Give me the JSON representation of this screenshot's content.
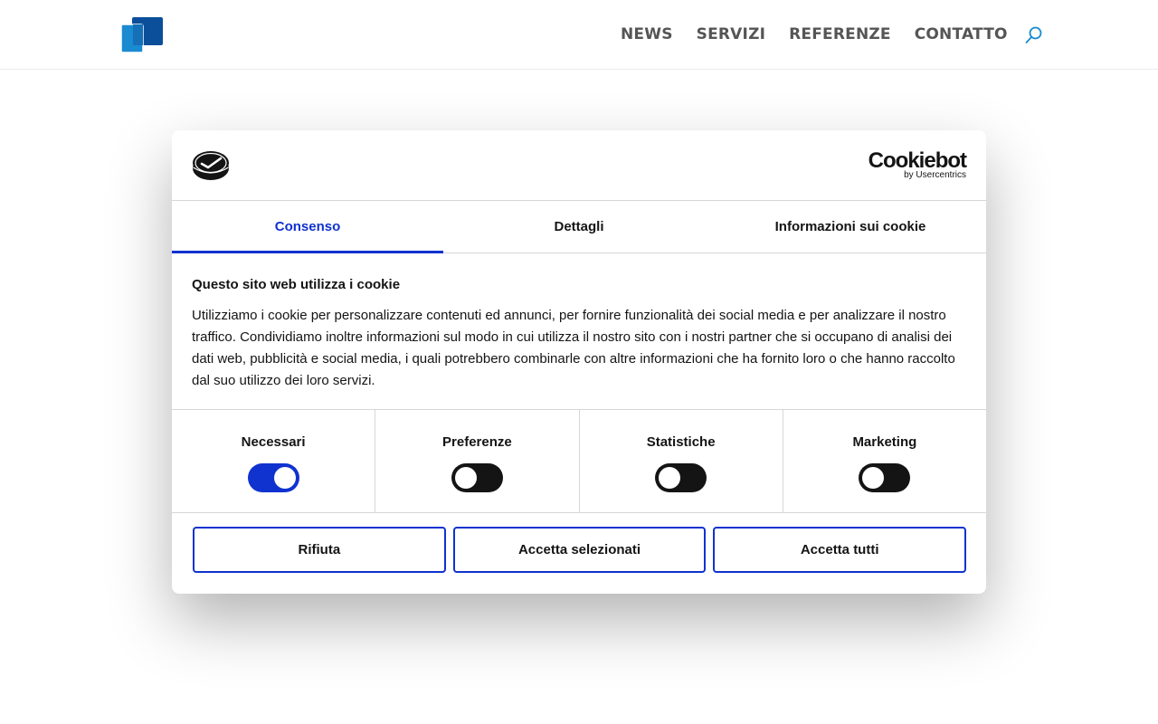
{
  "header": {
    "logo_icon": "company-logo",
    "nav": [
      "NEWS",
      "SERVIZI",
      "REFERENZE",
      "CONTATTO"
    ],
    "search_icon": "search-icon"
  },
  "dialog": {
    "brand_icon": "cookie-brand-mark",
    "provider": {
      "name": "Cookiebot",
      "by": "by Usercentrics"
    },
    "tabs": [
      {
        "label": "Consenso",
        "active": true
      },
      {
        "label": "Dettagli",
        "active": false
      },
      {
        "label": "Informazioni sui cookie",
        "active": false
      }
    ],
    "title": "Questo sito web utilizza i cookie",
    "text": "Utilizziamo i cookie per personalizzare contenuti ed annunci, per fornire funzionalità dei social media e per analizzare il nostro traffico. Condividiamo inoltre informazioni sul modo in cui utilizza il nostro sito con i nostri partner che si occupano di analisi dei dati web, pubblicità e social media, i quali potrebbero combinarle con altre informazioni che ha fornito loro o che hanno raccolto dal suo utilizzo dei loro servizi.",
    "categories": [
      {
        "label": "Necessari",
        "enabled": true
      },
      {
        "label": "Preferenze",
        "enabled": false
      },
      {
        "label": "Statistiche",
        "enabled": false
      },
      {
        "label": "Marketing",
        "enabled": false
      }
    ],
    "buttons": {
      "reject": "Rifiuta",
      "accept_selected": "Accetta selezionati",
      "accept_all": "Accetta tutti"
    },
    "accent_color": "#1032cf"
  }
}
